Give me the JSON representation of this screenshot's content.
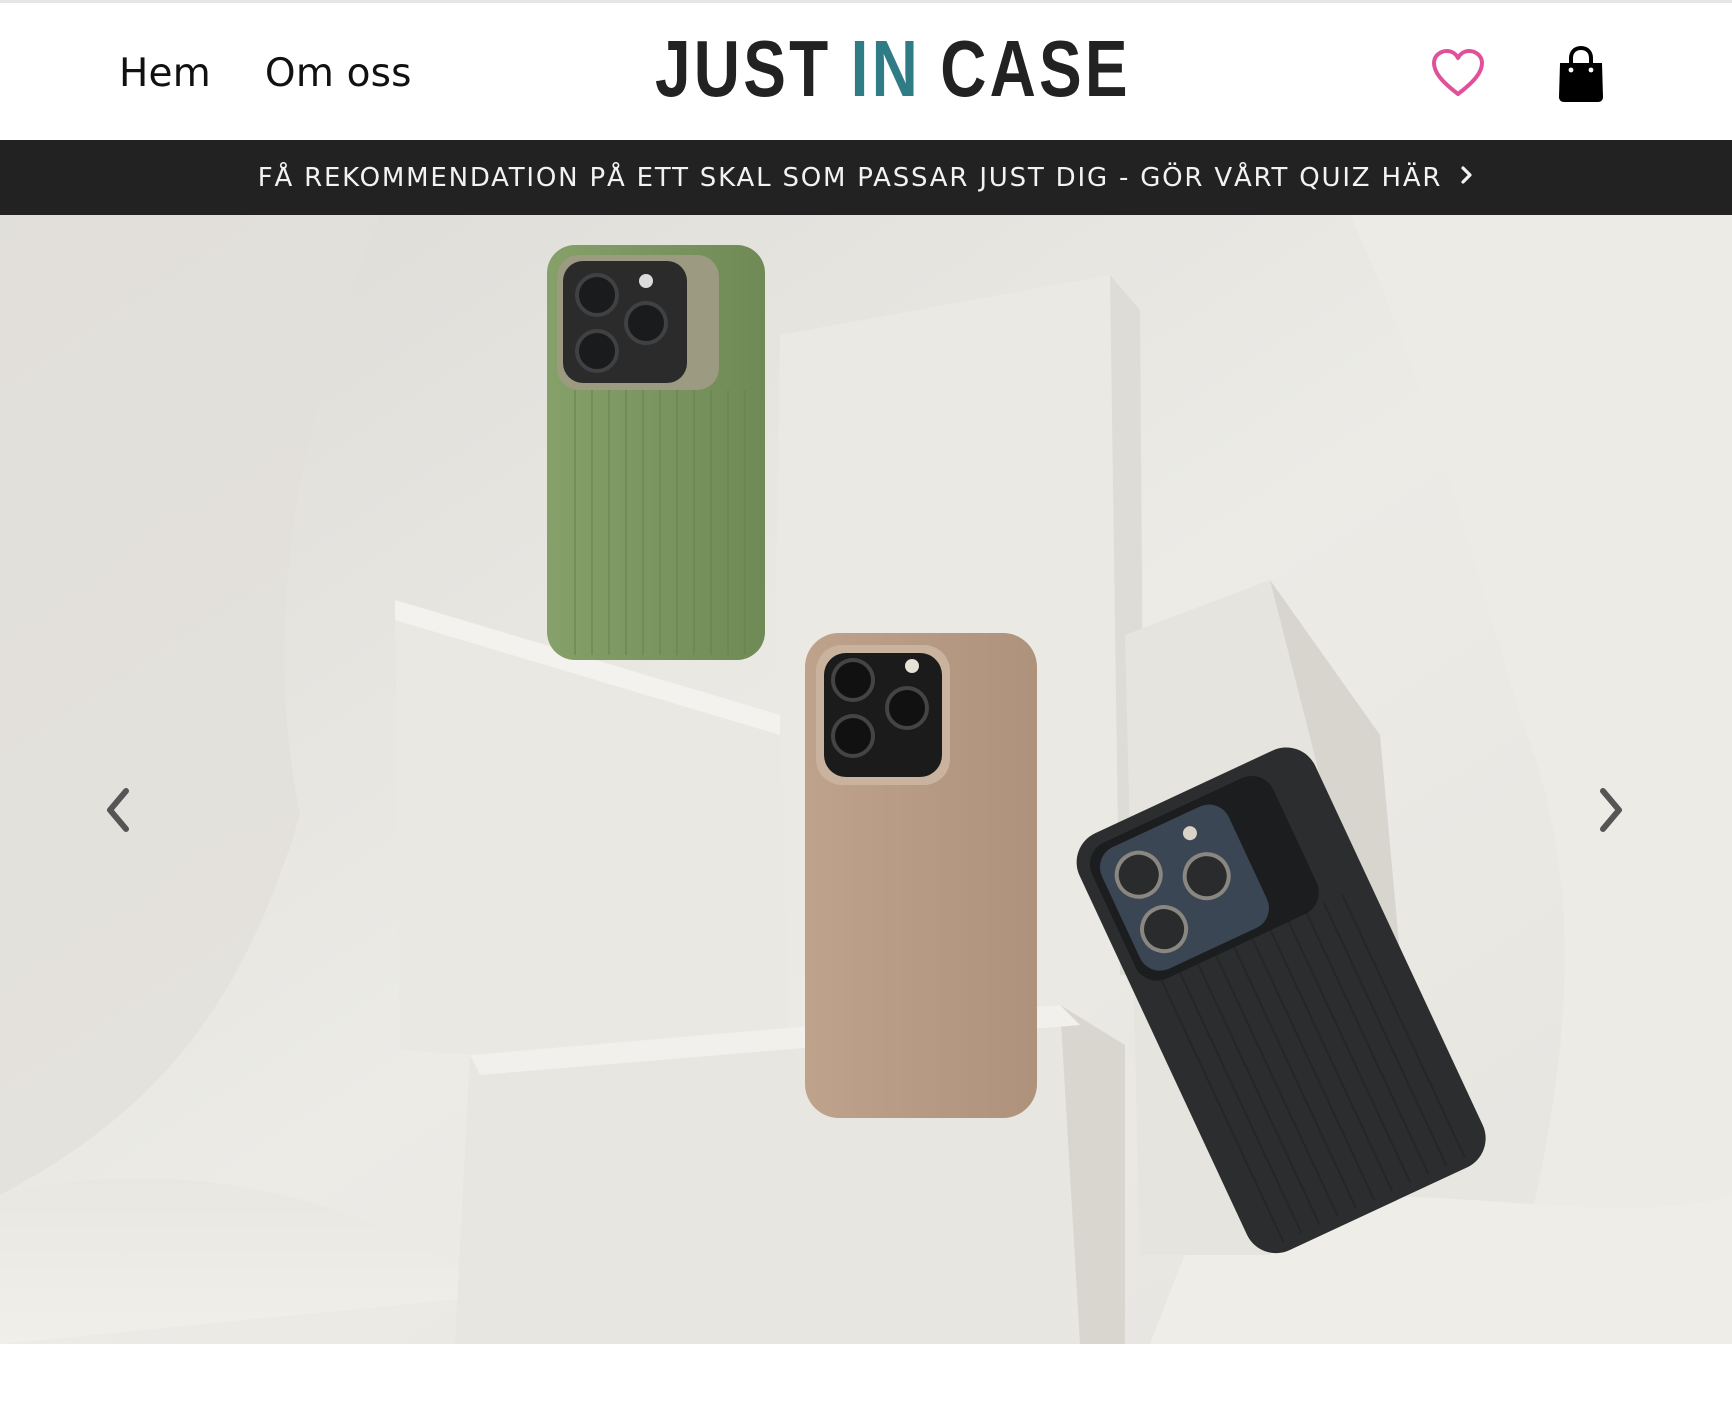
{
  "header": {
    "nav": [
      {
        "label": "Hem"
      },
      {
        "label": "Om oss"
      }
    ],
    "logo": {
      "word1": "JUST",
      "word2": "IN",
      "word3": "CASE"
    },
    "icons": {
      "wishlist": "heart-icon",
      "cart": "shopping-bag-icon"
    }
  },
  "announcement": {
    "text": "FÅ REKOMMENDATION PÅ ETT SKAL SOM PASSAR JUST DIG - GÖR VÅRT QUIZ HÄR",
    "icon": "chevron-right-icon"
  },
  "hero": {
    "prev_icon": "chevron-left-icon",
    "next_icon": "chevron-right-icon",
    "phone_cases": [
      {
        "color": "#7f9a63"
      },
      {
        "color": "#b89c86"
      },
      {
        "color": "#2b2c2e"
      }
    ]
  },
  "colors": {
    "accent": "#2f7c86",
    "heart": "#e0519a",
    "bar": "#222222"
  }
}
